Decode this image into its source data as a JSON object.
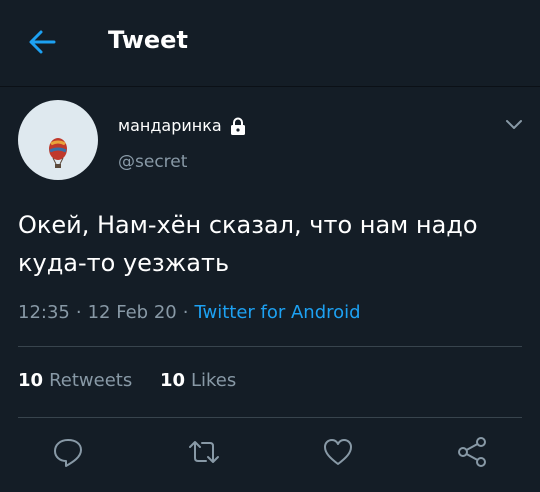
{
  "header": {
    "title": "Tweet",
    "back_icon": "arrow-left-icon"
  },
  "tweet": {
    "author_name": "мандаринка",
    "author_handle": "@secret",
    "protected_icon": "lock-icon",
    "text_line1": "Окей, Нам-хён сказал, что нам надо",
    "text_line2": "куда-то уезжать",
    "time": "12:35",
    "date": "12 Feb 20",
    "separator": "·",
    "source": "Twitter for Android"
  },
  "stats": {
    "retweets_count": "10",
    "retweets_label": "Retweets",
    "likes_count": "10",
    "likes_label": "Likes"
  },
  "actions": [
    "reply-icon",
    "retweet-icon",
    "like-icon",
    "share-icon"
  ],
  "colors": {
    "background": "#141d26",
    "accent": "#1da1f2",
    "secondary_text": "#8899a6",
    "divider": "#38444d"
  }
}
